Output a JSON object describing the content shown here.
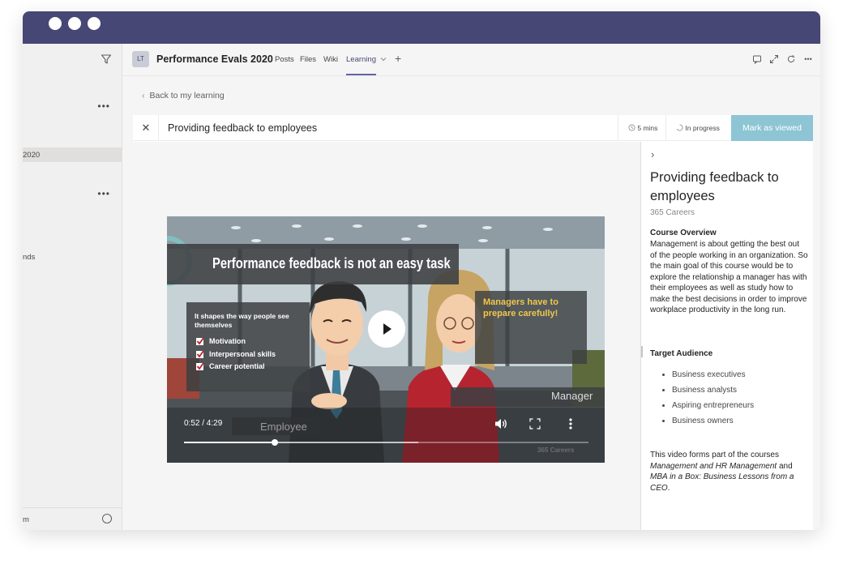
{
  "left_pane": {
    "item_label": "2020",
    "item_partial": "nds",
    "bottom_label": "m"
  },
  "header": {
    "team_avatar": "LT",
    "team_name": "Performance Evals 2020",
    "tabs": [
      {
        "label": "Posts"
      },
      {
        "label": "Files"
      },
      {
        "label": "Wiki"
      },
      {
        "label": "Learning"
      }
    ],
    "add_tab_label": "+"
  },
  "main": {
    "back_label": "Back to my learning",
    "course_title": "Providing feedback to employees",
    "duration": "5 mins",
    "status": "In progress",
    "mark_button": "Mark as viewed"
  },
  "video": {
    "headline": "Performance feedback is not an easy task",
    "intro": "It shapes  the way people see themselves",
    "checklist": [
      "Motivation",
      "Interpersonal skills",
      "Career potential"
    ],
    "quote": "Managers have to prepare carefully!",
    "label_manager": "Manager",
    "label_employee": "Employee",
    "time": "0:52 / 4:29",
    "watermark": "365 Careers",
    "progress": 0.225,
    "buffered": 0.58
  },
  "side": {
    "title": "Providing feedback to employees",
    "provider": "365 Careers",
    "overview_heading": "Course Overview",
    "overview_text": "Management is about getting the best out of the people working in an organization. So the main goal of this course would be to explore the relationship a manager has with their employees as well as study how to make the best decisions in order to improve workplace productivity in the long run.",
    "audience_heading": "Target Audience",
    "audience": [
      "Business executives",
      "Business analysts",
      "Aspiring entrepreneurs",
      "Business owners"
    ],
    "footer_prefix": "This video forms part of the courses ",
    "footer_course1": "Management and HR Management",
    "footer_and": " and ",
    "footer_course2": "MBA in a Box: Business Lessons from a CEO",
    "footer_suffix": "."
  },
  "colors": {
    "titlebar": "#464775",
    "accent": "#6264a7",
    "mark_button": "#8dc5d4"
  }
}
